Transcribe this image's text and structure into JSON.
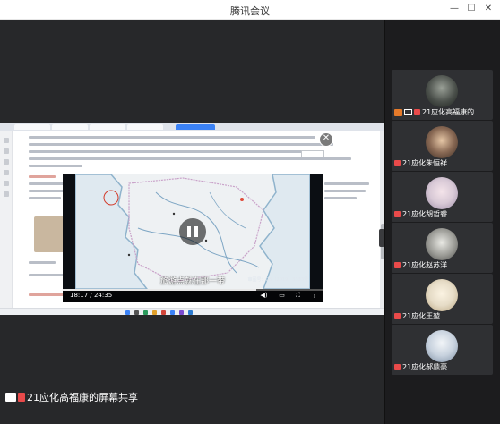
{
  "window": {
    "title": "腾讯会议",
    "minimize_glyph": "—",
    "maximize_glyph": "☐",
    "close_glyph": "✕"
  },
  "share": {
    "sharer_label": "21应化高福康的屏幕共享",
    "video": {
      "subtitle": "旅游点就在那一带",
      "copyright": "审图号：GS（2019）3333号",
      "time": "18:17 / 24:35",
      "progress": 0.744,
      "close_glyph": "✕",
      "fullscreen_glyph": "⛶",
      "more_glyph": "⋮",
      "volume_glyph": "◀)",
      "pip_glyph": "▭"
    }
  },
  "participants": [
    {
      "name": "21应化高福康的...",
      "avatar": "circle",
      "color": "#4a4f4a",
      "host": true,
      "sharing": true
    },
    {
      "name": "21应化朱恒祥",
      "avatar": "circle",
      "color": "#8a6a55",
      "host": false,
      "sharing": false
    },
    {
      "name": "21应化胡哲睿",
      "avatar": "circle",
      "color": "#d8c9d6",
      "host": false,
      "sharing": false
    },
    {
      "name": "21应化赵苏洋",
      "avatar": "circle",
      "color": "#9a9a95",
      "host": false,
      "sharing": false
    },
    {
      "name": "21应化王堃",
      "avatar": "circle",
      "color": "#e6dcc7",
      "host": false,
      "sharing": false
    },
    {
      "name": "21应化郝鼎豪",
      "avatar": "circle",
      "color": "#c8d2de",
      "host": false,
      "sharing": false
    }
  ],
  "colors": {
    "background": "#2a2a2b",
    "sidebar": "#1c1c1e",
    "tile": "#2f3033",
    "muted_icon": "#e94a4a",
    "host_badge": "#e57a2a"
  }
}
